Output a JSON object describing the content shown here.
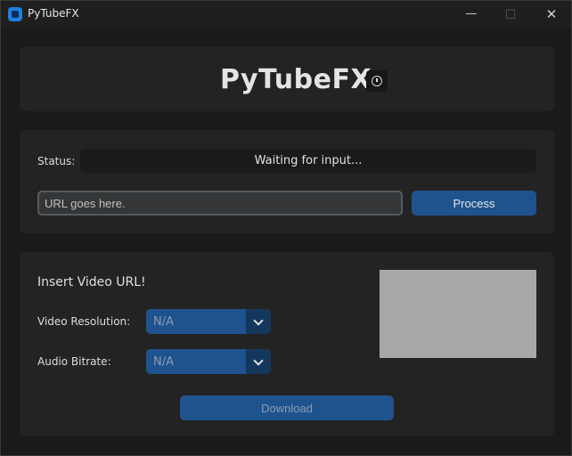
{
  "window": {
    "title": "PyTubeFX",
    "controls": {
      "minimize": "—",
      "maximize": "□",
      "close": "✕"
    }
  },
  "header": {
    "app_title": "PyTubeFX",
    "info_icon": "info-icon"
  },
  "input": {
    "status_label": "Status:",
    "status_text": "Waiting for input...",
    "url_placeholder": "URL goes here.",
    "url_value": "",
    "process_label": "Process"
  },
  "options": {
    "insert_label": "Insert Video URL!",
    "resolution_label": "Video Resolution:",
    "resolution_value": "N/A",
    "audio_label": "Audio Bitrate:",
    "audio_value": "N/A",
    "download_label": "Download"
  },
  "colors": {
    "accent": "#1f538d",
    "background": "#1a1a1a",
    "panel": "#232323",
    "thumbnail_placeholder": "#a8a8a8"
  }
}
